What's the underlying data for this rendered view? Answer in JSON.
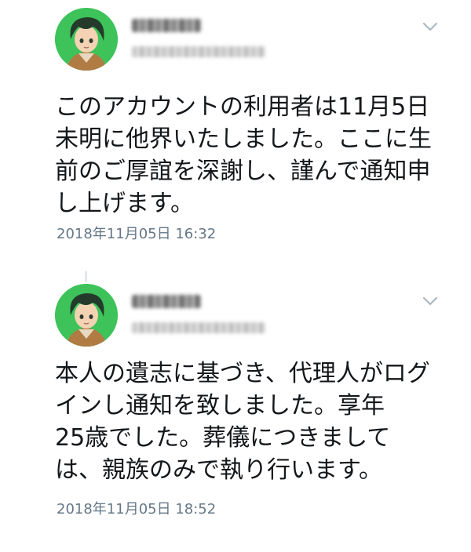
{
  "tweets": [
    {
      "avatar_icon": "anime-character-avatar",
      "lines": [
        "このアカウントの利用者は11月5日",
        "未明に他界いたしました。ここに生",
        "前のご厚誼を深謝し、謹んで通知申",
        "し上げます。"
      ],
      "timestamp": "2018年11月05日 16:32"
    },
    {
      "avatar_icon": "anime-character-avatar",
      "lines": [
        "本人の遺志に基づき、代理人がログ",
        "インし通知を致しました。享年",
        "25歳でした。葬儀につきまして",
        "は、親族のみで執り行います。"
      ],
      "timestamp": "2018年11月05日 18:52"
    }
  ],
  "colors": {
    "avatar_bg": "#3ec35a",
    "timestamp": "#657786",
    "text": "#14171a",
    "chevron": "#aab8c2"
  },
  "icons": {
    "menu": "chevron-down-icon"
  }
}
